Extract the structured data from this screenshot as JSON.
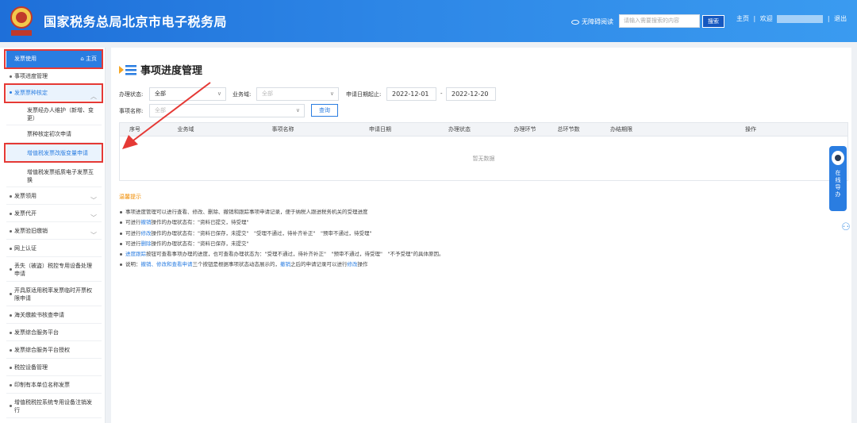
{
  "header": {
    "site_title": "国家税务总局北京市电子税务局",
    "accessibility": "无障碍阅读",
    "search_placeholder": "请输入需要搜索的内容",
    "search_button": "搜索",
    "home_link": "主页",
    "welcome": "欢迎",
    "logout": "退出",
    "separator": "|"
  },
  "sidebar": {
    "top": {
      "label": "发票使用",
      "home": "主页"
    },
    "items": [
      {
        "label": "事项进度管理"
      },
      {
        "label": "发票票种核定"
      },
      {
        "label": "发票经办人维护（新增、变更）"
      },
      {
        "label": "票种核定初次申请"
      },
      {
        "label": "增值税发票改版变量申请"
      },
      {
        "label": "增值税发票纸质电子发票互换"
      },
      {
        "label": "发票领用"
      },
      {
        "label": "发票代开"
      },
      {
        "label": "发票验旧缴销"
      },
      {
        "label": "网上认证"
      },
      {
        "label": "丢失（被盗）税控专用设备处理申请"
      },
      {
        "label": "开具原适用税率发票临时开票权限申请"
      },
      {
        "label": "海关缴款书核查申请"
      },
      {
        "label": "发票综合服务平台"
      },
      {
        "label": "发票综合服务平台授权"
      },
      {
        "label": "税控设备管理"
      },
      {
        "label": "印制有本单位名称发票"
      },
      {
        "label": "增值税税控系统专用设备注销发行"
      }
    ]
  },
  "main": {
    "title": "事项进度管理",
    "filters": {
      "status_label": "办理状态:",
      "status_value": "全部",
      "domain_label": "业务域:",
      "domain_value": "全部",
      "date_label": "申请日期起止:",
      "date_start": "2022-12-01",
      "date_sep": "-",
      "date_end": "2022-12-20",
      "item_label": "事项名称:",
      "item_value": "全部",
      "query_button": "查询"
    },
    "table": {
      "columns": [
        "序号",
        "业务域",
        "事项名称",
        "申请日期",
        "办理状态",
        "办理环节",
        "总环节数",
        "办结期限",
        "操作"
      ],
      "empty_text": "暂无数据"
    },
    "tips": {
      "title": "温馨提示",
      "lines": [
        [
          "事项进度管理可以进行查看、修改、删除、撤销和跟踪事项申请记录，便于纳税人跟进税务机关的受理进度"
        ],
        [
          "可进行",
          "撤销",
          "操作的办理状态有：\"资料已提交，待受理\""
        ],
        [
          "可进行",
          "修改",
          "操作的办理状态有：\"资料已保存，未提交\"　\"受理不通过，待补齐补正\"　\"预审不通过，待受理\""
        ],
        [
          "可进行",
          "删除",
          "操作的办理状态有：\"资料已保存，未提交\""
        ],
        [
          "",
          "进度跟踪",
          "按钮可查看事项办理的进度，也可查看办理状态为：\"受理不通过，待补齐补正\"　\"预审不通过，待受理\"　\"不予受理\"的具体原因。"
        ],
        [
          "说明：",
          "撤销、修改和查看申请",
          "三个按钮是根据事项状态动态展示的，",
          "撤销",
          "之后的申请记录可以进行",
          "修改",
          "操作"
        ]
      ]
    }
  },
  "float_help": {
    "label": "在线导办"
  },
  "colors": {
    "header": "#2d86e6",
    "accent": "#2a7de1",
    "highlight": "#e53935",
    "tip_title": "#f08c00"
  }
}
